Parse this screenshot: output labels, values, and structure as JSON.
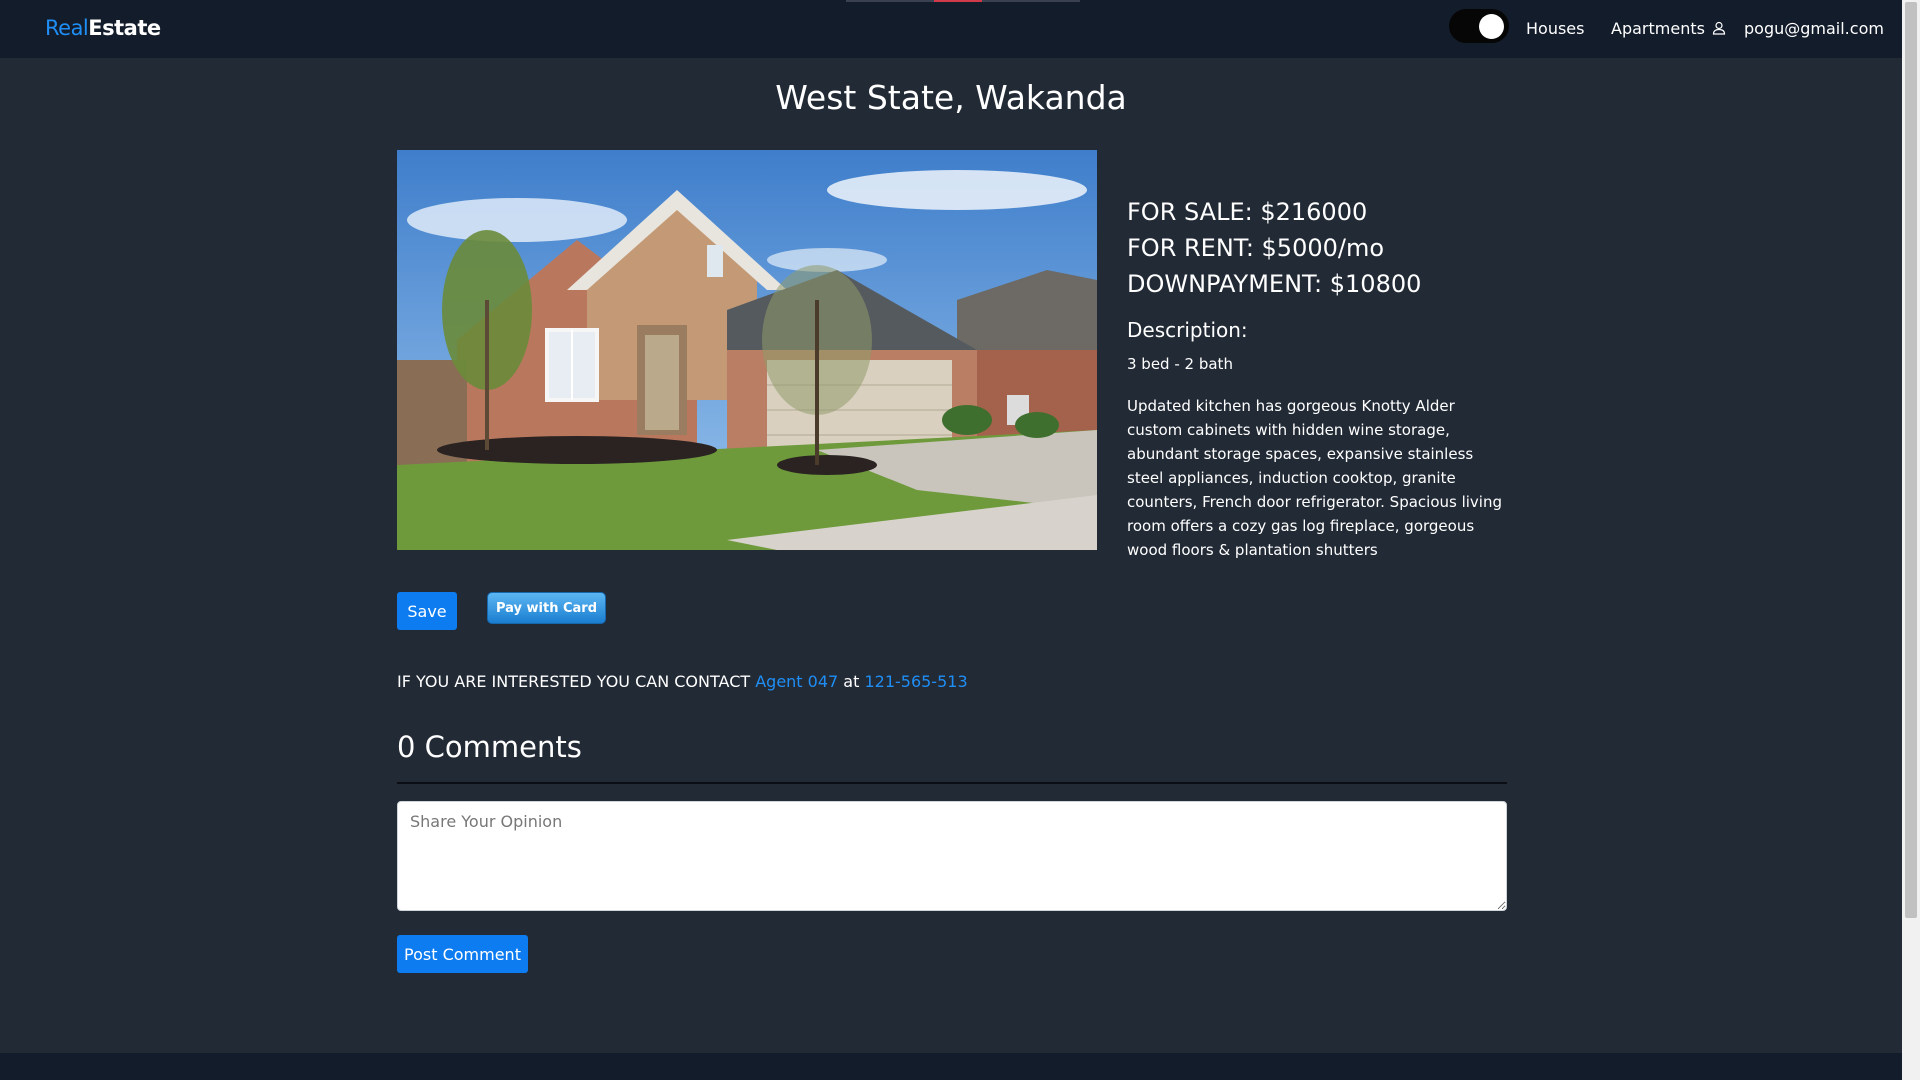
{
  "brand": {
    "part1": "Real",
    "part2": "Estate"
  },
  "nav": {
    "houses": "Houses",
    "apartments": "Apartments",
    "email": "pogu@gmail.com"
  },
  "listing": {
    "title": "West State, Wakanda",
    "for_sale": "FOR SALE: $216000",
    "for_rent": "FOR RENT: $5000/mo",
    "downpayment": "DOWNPAYMENT: $10800",
    "description_heading": "Description:",
    "bed_bath": "3 bed - 2 bath",
    "description": "Updated kitchen has gorgeous Knotty Alder custom cabinets with hidden wine storage, abundant storage spaces, expansive stainless steel appliances, induction cooktop, granite counters, French door refrigerator. Spacious living room offers a cozy gas log fireplace, gorgeous wood floors & plantation shutters"
  },
  "actions": {
    "save": "Save",
    "pay_card": "Pay with Card"
  },
  "contact": {
    "prefix": "IF YOU ARE INTERESTED YOU CAN CONTACT ",
    "agent": "Agent 047",
    "middle": " at ",
    "phone": "121-565-513"
  },
  "comments": {
    "heading": "0 Comments",
    "placeholder": "Share Your Opinion",
    "post": "Post Comment"
  },
  "colors": {
    "background": "#222a36",
    "navbar": "#131c2b",
    "accent": "#1f8ef5",
    "button": "#0d7cf0"
  },
  "icons": {
    "theme": "theme-toggle",
    "user": "user-icon",
    "photo": "house-photo"
  }
}
